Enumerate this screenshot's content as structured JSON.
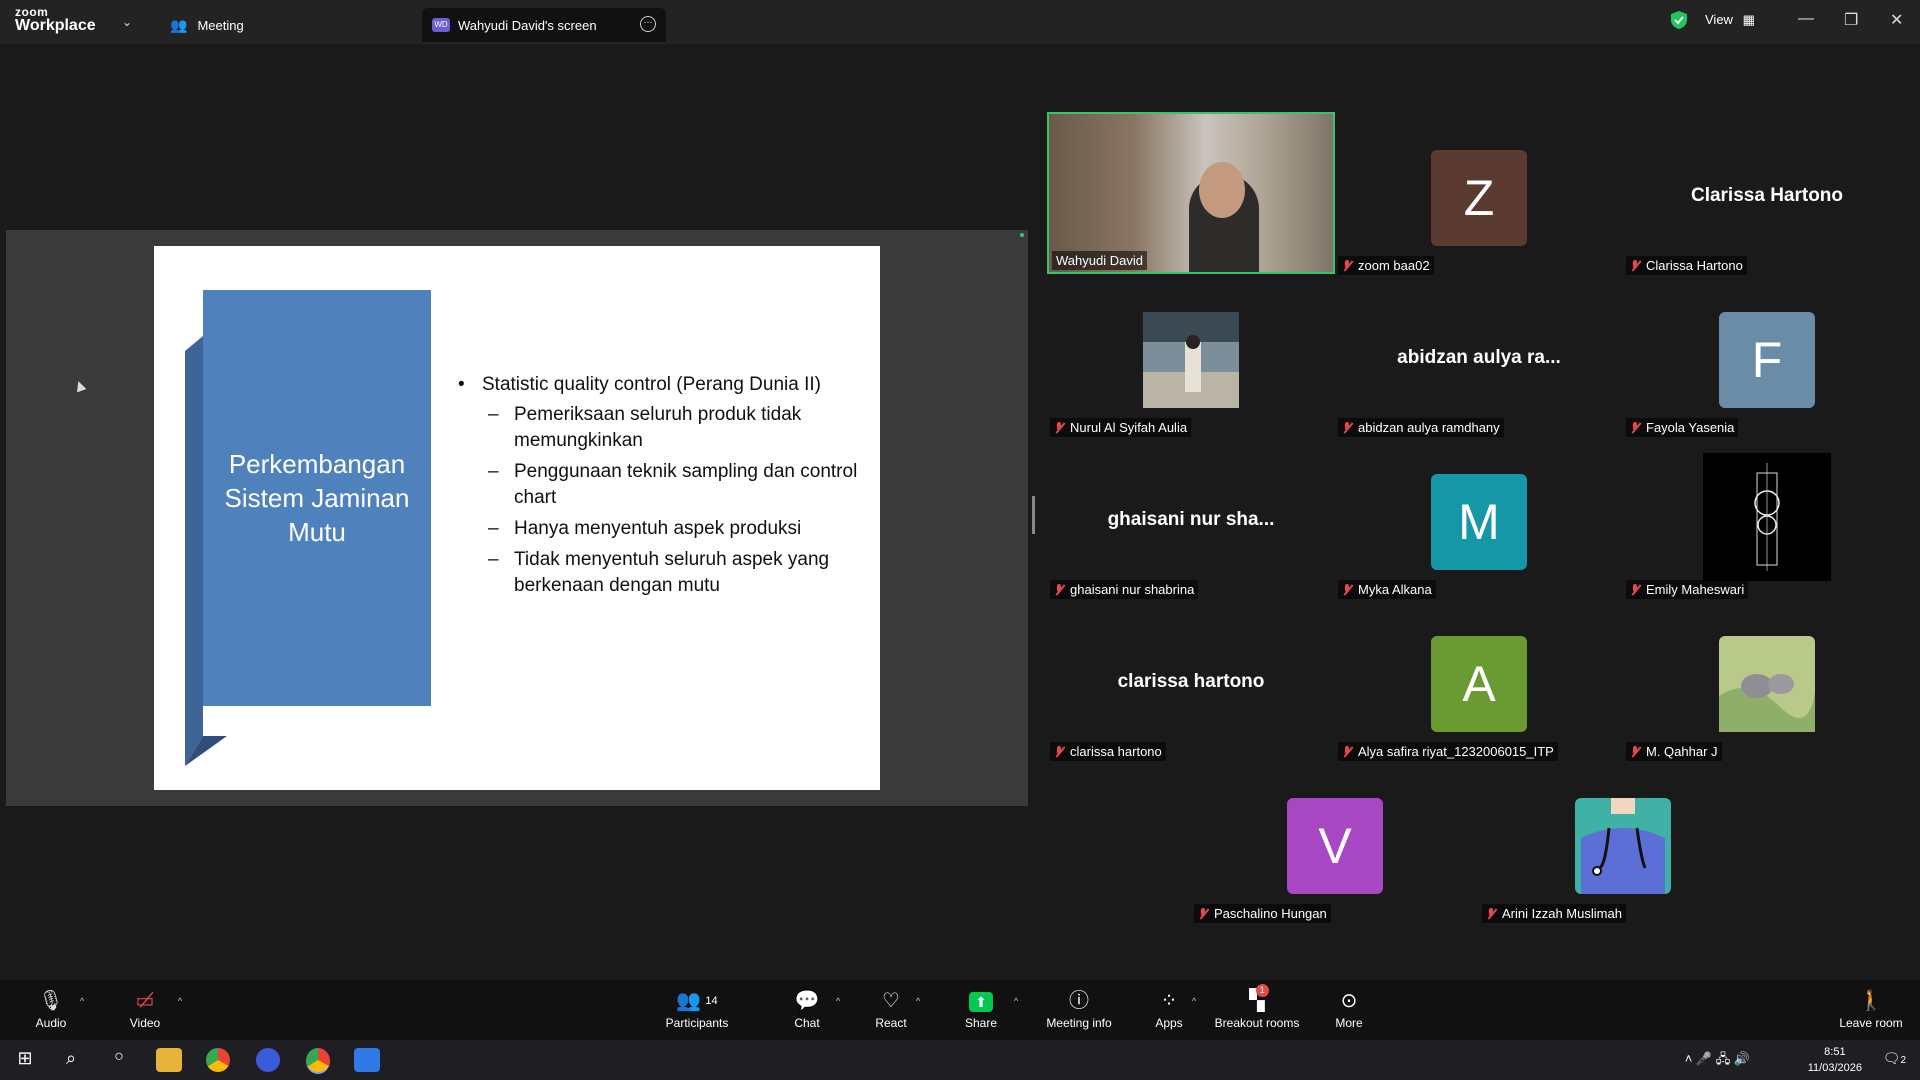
{
  "titlebar": {
    "logo_top": "zoom",
    "logo_bottom": "Workplace",
    "tab_meeting": "Meeting",
    "tab_screen_badge": "WD",
    "tab_screen": "Wahyudi David's screen",
    "view_label": "View"
  },
  "slide": {
    "title": "Perkembangan Sistem Jaminan Mutu",
    "bullet": "Statistic quality control (Perang Dunia II)",
    "sub_bullets": [
      "Pemeriksaan seluruh produk tidak memungkinkan",
      "Penggunaan teknik sampling dan control chart",
      "Hanya menyentuh aspek produksi",
      "Tidak menyentuh seluruh aspek yang berkenaan dengan mutu"
    ]
  },
  "participants": [
    {
      "name": "Wahyudi David",
      "kind": "video"
    },
    {
      "name": "zoom baa02",
      "kind": "letter",
      "letter": "Z",
      "color": "#5b3a32"
    },
    {
      "name": "Clarissa Hartono",
      "kind": "text",
      "display": "Clarissa Hartono"
    },
    {
      "name": "Nurul Al Syifah Aulia",
      "kind": "photo"
    },
    {
      "name": "abidzan aulya ramdhany",
      "kind": "text",
      "display": "abidzan aulya ra..."
    },
    {
      "name": "Fayola Yasenia",
      "kind": "letter",
      "letter": "F",
      "color": "#6b8ca6"
    },
    {
      "name": "ghaisani nur shabrina",
      "kind": "text",
      "display": "ghaisani nur sha..."
    },
    {
      "name": "Myka Alkana",
      "kind": "letter",
      "letter": "M",
      "color": "#1597a8"
    },
    {
      "name": "Emily Maheswari",
      "kind": "photo"
    },
    {
      "name": "clarissa hartono",
      "kind": "text",
      "display": "clarissa hartono"
    },
    {
      "name": "Alya safira riyat_1232006015_ITP",
      "kind": "letter",
      "letter": "A",
      "color": "#6a9a32"
    },
    {
      "name": "M. Qahhar J",
      "kind": "photo"
    },
    {
      "name": "Paschalino Hungan",
      "kind": "letter",
      "letter": "V",
      "color": "#a747c4"
    },
    {
      "name": "Arini Izzah Muslimah",
      "kind": "photo"
    }
  ],
  "toolbar": {
    "audio": "Audio",
    "video": "Video",
    "participants": "Participants",
    "participants_count": "14",
    "chat": "Chat",
    "react": "React",
    "share": "Share",
    "meeting_info": "Meeting info",
    "apps": "Apps",
    "breakout": "Breakout rooms",
    "breakout_badge": "1",
    "more": "More",
    "leave": "Leave room"
  },
  "taskbar": {
    "time": "8:51",
    "date": "11/03/2026",
    "notif_count": "2"
  },
  "colors": {
    "slide_panel": "#4f81bd",
    "active_speaker": "#37c46b",
    "share_green": "#00c853",
    "muted_red": "#e24a4a"
  }
}
